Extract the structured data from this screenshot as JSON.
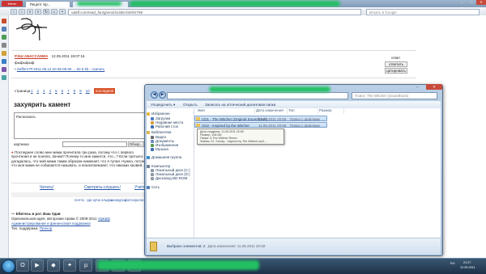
{
  "browser": {
    "menu_label": "Меню",
    "tabs": [
      {
        "label": "Рецепт Sp..."
      },
      {
        "label": ""
      }
    ],
    "url": "udaff.com/read_fun/gnvns/31465.html#2799",
    "search_placeholder": "Искать в Google"
  },
  "page": {
    "author": "РЭШ АБАССАМИА",
    "date": "12.05.2011 19:07:16",
    "sub_label": "ответ",
    "text_fafofof": "фыфыфыф",
    "attachment": "Seffers?P.2011.05.12.20.05.09.90 ... 62.6 kb - скачать",
    "reply_btn": "ответить",
    "quote_btn": "цитировать",
    "pager_label": "страница",
    "pager": [
      "1",
      "2",
      "3",
      "4",
      "5",
      "6",
      "7",
      "8",
      "9",
      "10"
    ],
    "last_btn": "последняя",
    "section_title": "захуярить камент",
    "textarea_value": "Распознать",
    "picture_label": "картинка",
    "browse_btn": "Обзор...",
    "disclaimer": "Последнее слово мне мама прочитала три раза, потому что с первого прочтения я не поняла. Зачем? Почему-то мне кажется, что...? Если третьего я догадалась, что мой мама таким образом намекает, что я тупая. Нужно, потому что моя мама не собирается называть, и предупреждает, что никаких кровей...",
    "links_row1": [
      "Читать!",
      "Смотреть-слушать!",
      "Учить!"
    ],
    "links_row2": [
      "почта",
      "где куча",
      "эльфы",
      "конкурсы",
      "фото",
      "кукла",
      "мульты"
    ],
    "footer_title": "— Ебитесь в рот. Ваш Удав",
    "footer_line1": "Оригинальная идея, авторские права © 2009-2011",
    "footer_link1": "Удафф",
    "footer_line2": "Администрирование и финансовая поддержка",
    "footer_line3": "Тех. поддержка:",
    "footer_link3": "Прохор"
  },
  "explorer": {
    "search_placeholder": "Поиск: The Witcher (Soundtrack)",
    "toolbar": [
      "Упорядочить ▾",
      "Открыть",
      "Записать на оптический диск",
      "Новая папка"
    ],
    "nav_items": [
      {
        "label": "Избранное",
        "color": "#e8b73a"
      },
      {
        "label": "Загрузки",
        "color": "#4a7cc0"
      },
      {
        "label": "Недавние места",
        "color": "#d29f3b"
      },
      {
        "label": "Рабочий стол",
        "color": "#3d6fb6"
      },
      {
        "label": "Библиотеки",
        "color": "#e3b350"
      },
      {
        "label": "Видео",
        "color": "#6b6b6b"
      },
      {
        "label": "Документы",
        "color": "#6b8ac0"
      },
      {
        "label": "Изображения",
        "color": "#5a9c55"
      },
      {
        "label": "Музыка",
        "color": "#3f6fb5"
      },
      {
        "label": "Домашняя группа",
        "color": "#3a8fc8"
      },
      {
        "label": "Компьютер",
        "color": "#6e7f95"
      },
      {
        "label": "Локальный диск (C:)",
        "color": "#8c99a8"
      },
      {
        "label": "Локальный диск (D:)",
        "color": "#8c99a8"
      },
      {
        "label": "Дисковод BD-ROM",
        "color": "#8c99a8"
      },
      {
        "label": "Сеть",
        "color": "#4e7fb8"
      }
    ],
    "columns": [
      "Имя",
      "Дата изменения",
      "Тип",
      "Размер"
    ],
    "files": [
      {
        "name": "CD1 - The Witcher (Original Soundtrack)",
        "date": "11.05.2011 20:59",
        "type": "Папка с файлами"
      },
      {
        "name": "CD2 - Inspired by the Witcher",
        "date": "11.05.2011 20:59",
        "type": "Папка с файлами"
      }
    ],
    "tooltip": [
      "Дата создания: 11.05.2011 20:59",
      "Размер: 156 МБ",
      "Папки: 5-The Witcher Remix",
      "Файлы: 01. Smoky - Inspired by The Witcher.mp3, ..."
    ],
    "status_selected": "Выбрано элементов: 2",
    "status_date": "Дата изменения: 11.05.2011 20:59"
  },
  "taskbar": {
    "lang": "RU",
    "time": "21:27",
    "date": "12.05.2011"
  }
}
